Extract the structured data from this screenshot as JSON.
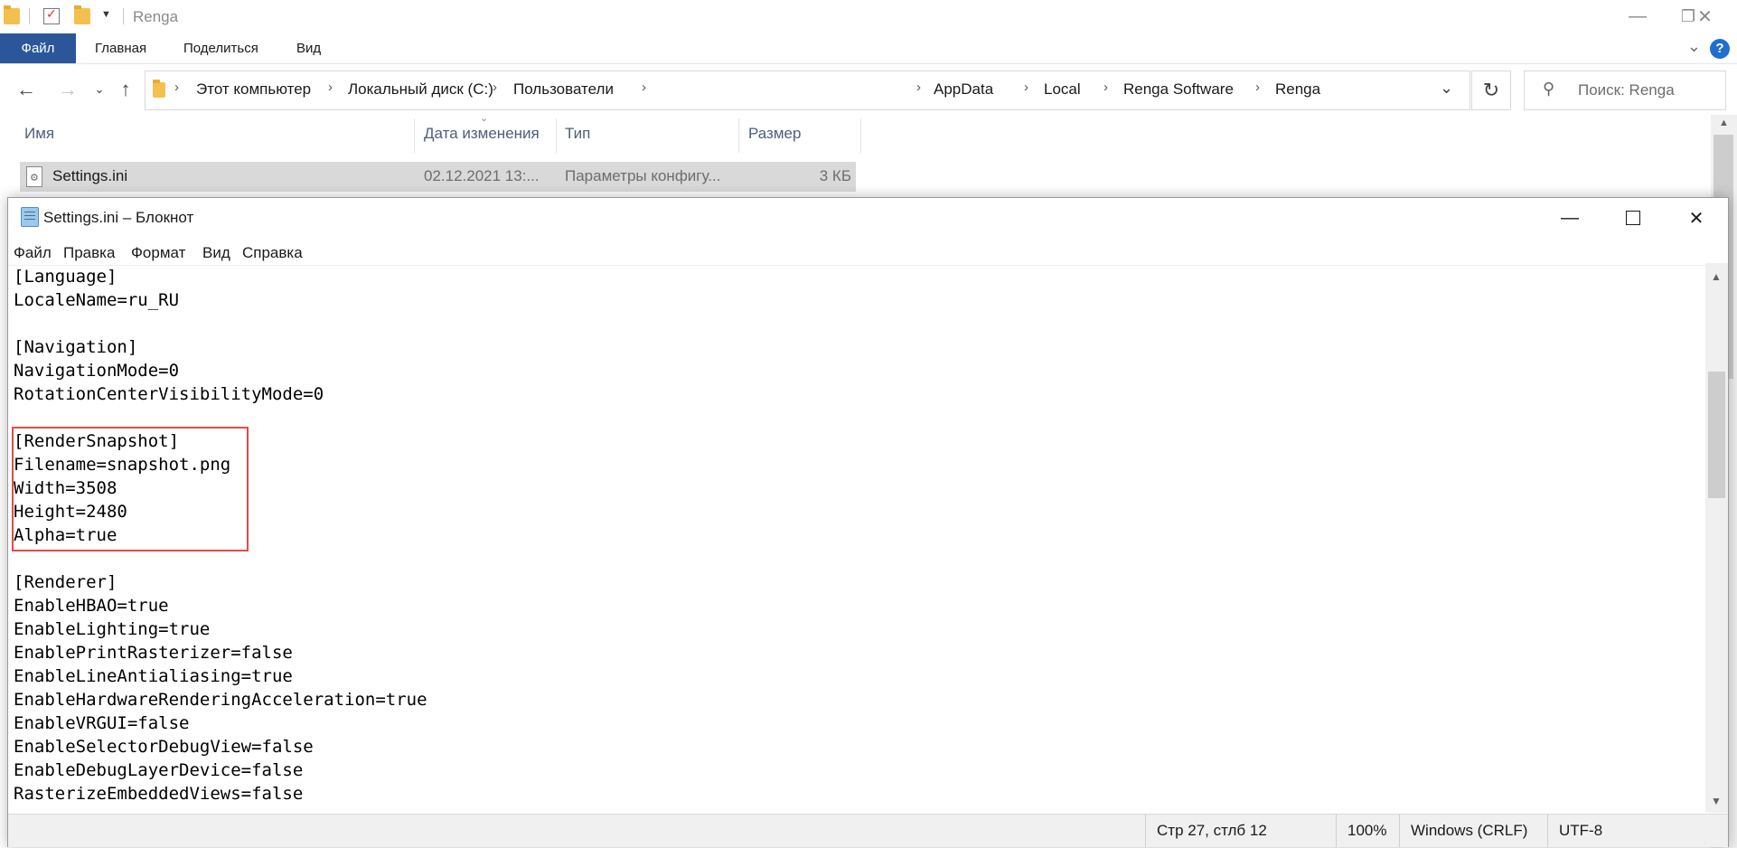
{
  "explorer": {
    "title": "Renga",
    "ribbon_tabs": [
      "Файл",
      "Главная",
      "Поделиться",
      "Вид"
    ],
    "help_label": "?",
    "breadcrumbs": [
      "Этот компьютер",
      "Локальный диск (C:)",
      "Пользователи",
      "AppData",
      "Local",
      "Renga Software",
      "Renga"
    ],
    "search_placeholder": "Поиск: Renga",
    "columns": [
      "Имя",
      "Дата изменения",
      "Тип",
      "Размер"
    ],
    "files": [
      {
        "name": "Settings.ini",
        "modified": "02.12.2021 13:...",
        "type": "Параметры конфигу...",
        "size": "3 КБ"
      }
    ]
  },
  "notepad": {
    "title": "Settings.ini – Блокнот",
    "menu": [
      "Файл",
      "Правка",
      "Формат",
      "Вид",
      "Справка"
    ],
    "lines": [
      "[Language]",
      "LocaleName=ru_RU",
      "",
      "[Navigation]",
      "NavigationMode=0",
      "RotationCenterVisibilityMode=0",
      "",
      "[RenderSnapshot]",
      "Filename=snapshot.png",
      "Width=3508",
      "Height=2480",
      "Alpha=true",
      "",
      "[Renderer]",
      "EnableHBAO=true",
      "EnableLighting=true",
      "EnablePrintRasterizer=false",
      "EnableLineAntialiasing=true",
      "EnableHardwareRenderingAcceleration=true",
      "EnableVRGUI=false",
      "EnableSelectorDebugView=false",
      "EnableDebugLayerDevice=false",
      "RasterizeEmbeddedViews=false"
    ],
    "status": {
      "position": "Стр 27, стлб 12",
      "zoom": "100%",
      "line_endings": "Windows (CRLF)",
      "encoding": "UTF-8"
    }
  }
}
